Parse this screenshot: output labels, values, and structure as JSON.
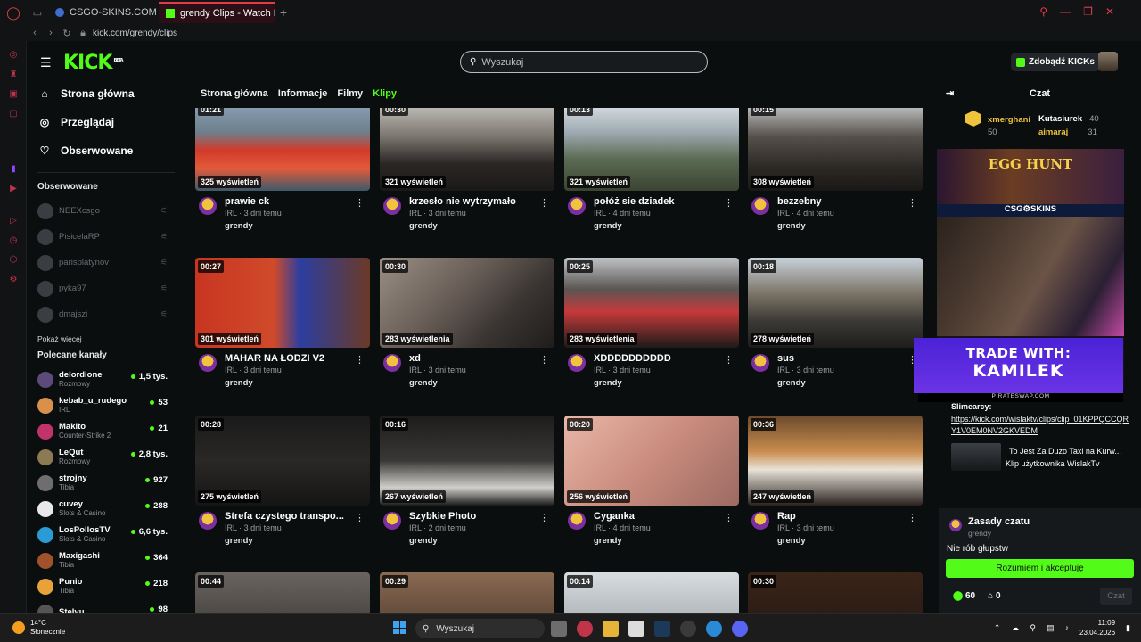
{
  "browser": {
    "tabs": [
      {
        "label": "CSGO-SKINS.COM - Najle"
      },
      {
        "label": "grendy Clips - Watch Live"
      }
    ],
    "url": "kick.com/grendy/clips"
  },
  "header": {
    "logo": "KICK",
    "logo_badge": "BETA",
    "search_placeholder": "Wyszukaj",
    "kicks_button": "Zdobądź KICKs"
  },
  "sidebar": {
    "nav": [
      {
        "label": "Strona główna",
        "icon": "home-icon"
      },
      {
        "label": "Przeglądaj",
        "icon": "compass-icon"
      },
      {
        "label": "Obserwowane",
        "icon": "heart-icon"
      }
    ],
    "followed_heading": "Obserwowane",
    "followed": [
      "NEEXcsgo",
      "PisicelaRP",
      "parisplatynov",
      "pyka97",
      "dmajszi"
    ],
    "show_more": "Pokaż więcej",
    "recommended_heading": "Polecane kanały",
    "recommended": [
      {
        "name": "delordione",
        "category": "Rozmowy",
        "viewers": "1,5 tys.",
        "color": "#5b4a7a"
      },
      {
        "name": "kebab_u_rudego",
        "category": "IRL",
        "viewers": "53",
        "color": "#d9904a"
      },
      {
        "name": "Makito",
        "category": "Counter-Strike 2",
        "viewers": "21",
        "color": "#c2336b"
      },
      {
        "name": "LeQut",
        "category": "Rozmowy",
        "viewers": "2,8 tys.",
        "color": "#8c7a52"
      },
      {
        "name": "strojny",
        "category": "Tibia",
        "viewers": "927",
        "color": "#6e6e6e"
      },
      {
        "name": "cuvey",
        "category": "Slots & Casino",
        "viewers": "288",
        "color": "#e8e8e8"
      },
      {
        "name": "LosPollosTV",
        "category": "Slots & Casino",
        "viewers": "6,6 tys.",
        "color": "#2b9bd6"
      },
      {
        "name": "Maxigashi",
        "category": "Tibia",
        "viewers": "364",
        "color": "#a0522d"
      },
      {
        "name": "Punio",
        "category": "Tibia",
        "viewers": "218",
        "color": "#e8a23a"
      },
      {
        "name": "Stelyu",
        "category": "",
        "viewers": "98",
        "color": "#555555"
      }
    ]
  },
  "subnav": [
    "Strona główna",
    "Informacje",
    "Filmy",
    "Klipy"
  ],
  "clips": [
    {
      "duration": "01:21",
      "views": "325 wyświetleń",
      "title": "prawie ck",
      "meta": "IRL · 3 dni temu",
      "user": "grendy"
    },
    {
      "duration": "00:30",
      "views": "321 wyświetleń",
      "title": "krzesło nie wytrzymało",
      "meta": "IRL · 3 dni temu",
      "user": "grendy"
    },
    {
      "duration": "00:13",
      "views": "321 wyświetleń",
      "title": "połóż sie dziadek",
      "meta": "IRL · 4 dni temu",
      "user": "grendy"
    },
    {
      "duration": "00:15",
      "views": "308 wyświetleń",
      "title": "bezzebny",
      "meta": "IRL · 4 dni temu",
      "user": "grendy"
    },
    {
      "duration": "00:27",
      "views": "301 wyświetleń",
      "title": "MAHAR NA ŁODZI V2",
      "meta": "IRL · 3 dni temu",
      "user": "grendy"
    },
    {
      "duration": "00:30",
      "views": "283 wyświetlenia",
      "title": "xd",
      "meta": "IRL · 3 dni temu",
      "user": "grendy"
    },
    {
      "duration": "00:25",
      "views": "283 wyświetlenia",
      "title": "XDDDDDDDDDD",
      "meta": "IRL · 3 dni temu",
      "user": "grendy"
    },
    {
      "duration": "00:18",
      "views": "278 wyświetleń",
      "title": "sus",
      "meta": "IRL · 3 dni temu",
      "user": "grendy"
    },
    {
      "duration": "00:28",
      "views": "275 wyświetleń",
      "title": "Strefa czystego transpo...",
      "meta": "IRL · 3 dni temu",
      "user": "grendy"
    },
    {
      "duration": "00:16",
      "views": "267 wyświetleń",
      "title": "Szybkie Photo",
      "meta": "IRL · 2 dni temu",
      "user": "grendy"
    },
    {
      "duration": "00:20",
      "views": "256 wyświetleń",
      "title": "Cyganka",
      "meta": "IRL · 4 dni temu",
      "user": "grendy"
    },
    {
      "duration": "00:36",
      "views": "247 wyświetleń",
      "title": "Rap",
      "meta": "IRL · 3 dni temu",
      "user": "grendy"
    },
    {
      "duration": "00:44",
      "views": "",
      "title": "",
      "meta": "",
      "user": ""
    },
    {
      "duration": "00:29",
      "views": "",
      "title": "",
      "meta": "",
      "user": ""
    },
    {
      "duration": "00:14",
      "views": "",
      "title": "",
      "meta": "",
      "user": ""
    },
    {
      "duration": "00:30",
      "views": "",
      "title": "",
      "meta": "",
      "user": ""
    }
  ],
  "chat": {
    "title": "Czat",
    "gifters": [
      {
        "name": "xmerghani",
        "value": "50",
        "color": "#f0c33c"
      },
      {
        "name": "Kutasiurek",
        "value": "40",
        "color": "#ffffff"
      },
      {
        "name": "aimaraj",
        "value": "31",
        "color": "#f0c33c"
      }
    ],
    "stream_banner": "EGG HUNT",
    "stream_brand": "CSG⚙SKINS",
    "trade_line1": "TRADE WITH:",
    "trade_line2": "KAMILEK",
    "pirate": "PIRATESWAP.COM",
    "message_user": "Slimearcy:",
    "message_link": "https://kick.com/wislaktv/clips/clip_01KPPQCCQRY1V0EM0NV2GKVEDM",
    "embed_title": "To Jest Za Duzo Taxi na Kurw...",
    "embed_sub": "Klip użytkownika WislakTv",
    "rules_title": "Zasady czatu",
    "rules_channel": "grendy",
    "rules_text": "Nie rób głupstw",
    "accept_button": "Rozumiem i akceptuję",
    "points": "60",
    "other_count": "0",
    "send_button": "Czat"
  },
  "taskbar": {
    "temperature": "14°C",
    "weather": "Słonecznie",
    "search": "Wyszukaj",
    "time": "11:09",
    "date": "23.04.2026"
  }
}
